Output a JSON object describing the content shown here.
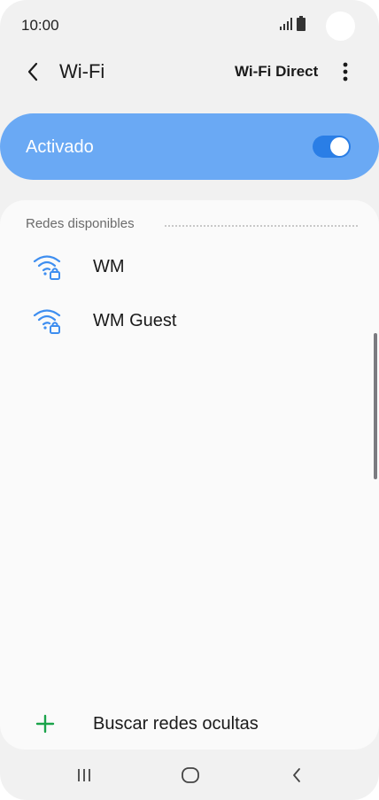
{
  "status_bar": {
    "time": "10:00",
    "icons": [
      "signal-icon",
      "battery-icon"
    ]
  },
  "header": {
    "title": "Wi-Fi",
    "wifi_direct_label": "Wi-Fi Direct",
    "back_icon": "back-arrow-icon",
    "more_icon": "more-vertical-icon"
  },
  "master_toggle": {
    "label": "Activado",
    "enabled": true,
    "card_color": "#6aa9f4",
    "track_color": "#2a7ee6"
  },
  "networks": {
    "section_label": "Redes disponibles",
    "items": [
      {
        "name": "WM",
        "icon": "wifi-lock-icon",
        "secured": true
      },
      {
        "name": "WM Guest",
        "icon": "wifi-lock-icon",
        "secured": true
      }
    ],
    "hidden_network": {
      "label": "Buscar redes ocultas",
      "icon": "plus-icon",
      "icon_color": "#1aa34a"
    }
  },
  "nav_bar": {
    "buttons": [
      "recents-icon",
      "home-icon",
      "back-icon"
    ]
  },
  "colors": {
    "accent": "#3e8ef0",
    "background": "#f1f1f1",
    "card": "#fafafa"
  }
}
